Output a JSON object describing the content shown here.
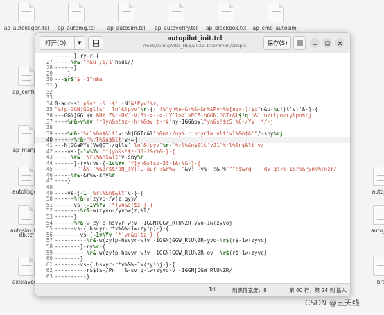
{
  "desktop": {
    "icons": [
      {
        "label": "ap_autolibgen.tcl",
        "col": 0,
        "row": 0
      },
      {
        "label": "ap_automg.tcl",
        "col": 1,
        "row": 0
      },
      {
        "label": "ap_autosim.tcl",
        "col": 2,
        "row": 0
      },
      {
        "label": "ap_autoverify.tcl",
        "col": 3,
        "row": 0
      },
      {
        "label": "ap_blackbox.tcl",
        "col": 4,
        "row": 0
      },
      {
        "label": "ap_cmd_autosim_",
        "col": 5,
        "row": 0
      },
      {
        "label": "ap_config_",
        "col": 0,
        "row": 1
      },
      {
        "label": "ap_manpa",
        "col": 0,
        "row": 2
      },
      {
        "label": "autolibgen",
        "col": 0,
        "row": 3
      },
      {
        "label": "auto_rt",
        "col": 6,
        "row": 3
      },
      {
        "label": "autosim_typ",
        "col": 0,
        "row": 4
      },
      {
        "label": "db.tcl",
        "col": 0,
        "row": 4.3
      },
      {
        "label": "auto_ve",
        "col": 6,
        "row": 4
      },
      {
        "label": "axislavege",
        "col": 0,
        "row": 5
      },
      {
        "label": "bra",
        "col": 6,
        "row": 5
      }
    ]
  },
  "window": {
    "open_label": "打开(O)",
    "title": "autopilot_init.tcl",
    "path": "/tools/Xilinx/Vitis_HLS/2022.1/common/scripts",
    "save_label": "保存(S)"
  },
  "editor": {
    "lines": [
      {
        "n": "",
        "parts": [
          [
            "",
            "------}-ry-r-{"
          ]
        ]
      },
      {
        "n": "27",
        "parts": [
          [
            "",
            "-----"
          ],
          [
            "k",
            "%r&"
          ],
          [
            "",
            "-"
          ],
          [
            "s",
            "\"n&u-/i/1\""
          ],
          [
            "",
            "n&ui//"
          ]
        ]
      },
      {
        "n": "28",
        "parts": [
          [
            "",
            "------}"
          ]
        ]
      },
      {
        "n": "29",
        "parts": [
          [
            "",
            "----}"
          ]
        ]
      },
      {
        "n": "30",
        "parts": [
          [
            "",
            "---"
          ],
          [
            "k",
            "$r&"
          ],
          [
            "s",
            "'$ -1\"n&u"
          ]
        ]
      },
      {
        "n": "31",
        "parts": [
          [
            "",
            ")"
          ]
        ]
      },
      {
        "n": "32",
        "parts": [
          [
            "",
            ""
          ]
        ]
      },
      {
        "n": "33",
        "parts": [
          [
            "",
            ""
          ]
        ]
      },
      {
        "n": "34",
        "parts": [
          [
            "",
            "0-aur-s"
          ],
          [
            "s",
            "' p&v! -&!-$' "
          ],
          [
            "",
            "-N"
          ],
          [
            "s",
            "'&!Pyv\"%r;"
          ]
        ]
      },
      {
        "n": "35",
        "parts": [
          [
            "s",
            "\"$!p-GGN|GGgl!$' "
          ],
          [
            "",
            " "
          ],
          [
            "s",
            "ln'&!pyv\""
          ],
          [
            "k",
            "%r"
          ],
          [
            "",
            "-{- "
          ],
          [
            "s",
            "!%\"yn%u-&r%&-&r%&Pyn%%[nzr-)!$x\""
          ],
          [
            "",
            "n&u-"
          ],
          [
            "k",
            "%u!"
          ],
          [
            "",
            ")t'v!'&-}-{"
          ]
        ]
      },
      {
        "n": "36",
        "parts": [
          [
            "",
            "---GGN]GG'$v "
          ],
          [
            "s",
            "&UY'Z%t-UY'-V|5\\->-->-UY'l>=l>EC8-hGGN]GGTr&l"
          ],
          [
            "k",
            "$!q"
          ],
          [
            "s",
            "'p&l nzrlpnzrylpn%rj"
          ]
        ]
      },
      {
        "n": "37",
        "parts": [
          [
            "",
            "----"
          ],
          [
            "k",
            "%r&-v%Yv"
          ],
          [
            "s",
            " '*]yn&s!$z--h-%&$v t-r#'"
          ],
          [
            "",
            "ny-1GG&pyl"
          ],
          [
            "s",
            "\"yn&s!$z5!%6-/Yv '*/-j"
          ]
        ]
      },
      {
        "n": "38",
        "parts": [
          [
            "",
            ""
          ]
        ]
      },
      {
        "n": "39",
        "parts": [
          [
            "",
            "----"
          ],
          [
            "k",
            "%r&"
          ],
          [
            "",
            "-"
          ],
          [
            "s",
            "'%rl%&n$&lt'"
          ],
          [
            "",
            "v-hN]GGTr&l"
          ],
          [
            "s",
            "\"n&nz-/uy%;r noyrlw vlt'vl%&n$&'\""
          ],
          [
            "",
            "/-sny"
          ],
          [
            "k",
            "%rj"
          ]
        ]
      },
      {
        "n": "40",
        "current": true,
        "parts": [
          [
            "",
            "------"
          ],
          [
            "k",
            "%r&"
          ],
          [
            "",
            "-"
          ],
          [
            "s",
            "'%rl%&n$&lt'"
          ],
          [
            "",
            "v-="
          ],
          [
            "cursor",
            ""
          ],
          [
            "",
            "|"
          ]
        ]
      },
      {
        "n": "41",
        "parts": [
          [
            "",
            "---N]GGaPYV[VaQOT-/qlls' "
          ],
          [
            "s",
            "ln'&!pyv\""
          ],
          [
            "k",
            "%r"
          ],
          [
            "",
            "-"
          ],
          [
            "s",
            "'%rl%&n$&lt'vJ1'%rl%&n$&lt'v/"
          ]
        ]
      },
      {
        "n": "42",
        "parts": [
          [
            "",
            "----vs-{"
          ],
          [
            "k",
            "-1v%Yv"
          ],
          [
            "s",
            " '*]yn&s!$z-33-1&r%&-}-{"
          ]
        ]
      },
      {
        "n": "43",
        "parts": [
          [
            "",
            "-----"
          ],
          [
            "k",
            "%r&"
          ],
          [
            "",
            "-"
          ],
          [
            "s",
            "'%rl%&n$&lt'"
          ],
          [
            "",
            "v-sny"
          ],
          [
            "k",
            "%r"
          ]
        ]
      },
      {
        "n": "44",
        "parts": [
          [
            "",
            "------}-ry%rvs-{"
          ],
          [
            "k",
            "-1v%Yv"
          ],
          [
            "s",
            " '*]yn&s!$z-33-1&r%&-}-{"
          ]
        ]
      },
      {
        "n": "45",
        "parts": [
          [
            "",
            "-------"
          ],
          [
            "s",
            "\"'&%-'%&qr$$/dN_[V[TG-aur-:&r%&-!\""
          ],
          [
            "",
            "&v! -v%- !&-%"
          ],
          [
            "s",
            "'\"\"!$&rq-! -dv q!)%-1&r%&Pyn%%[nzr/"
          ]
        ]
      },
      {
        "n": "46",
        "parts": [
          [
            "",
            "-----"
          ],
          [
            "k",
            "%r&"
          ],
          [
            "",
            "-&r%&-sny"
          ],
          [
            "k",
            "%r"
          ]
        ]
      },
      {
        "n": "47",
        "parts": [
          [
            "",
            "----}"
          ]
        ]
      },
      {
        "n": "48",
        "parts": [
          [
            "",
            ""
          ]
        ]
      },
      {
        "n": "49",
        "parts": [
          [
            "",
            "----vs-{"
          ],
          [
            "k",
            "-1"
          ],
          [
            "",
            " "
          ],
          [
            "s",
            "'%rl%&n$&lt'"
          ],
          [
            "",
            "v-}-{"
          ]
        ]
      },
      {
        "n": "50",
        "parts": [
          [
            "",
            "------"
          ],
          [
            "k",
            "%r&"
          ],
          [
            "",
            "-w(zyvo-/w(z;qyy/"
          ]
        ]
      },
      {
        "n": "51",
        "parts": [
          [
            "",
            "------vs-{"
          ],
          [
            "k",
            "-1v%Yv"
          ],
          [
            "s",
            " '*]yn&s!$z-}-{"
          ]
        ]
      },
      {
        "n": "52",
        "parts": [
          [
            "",
            "--------"
          ],
          [
            "k",
            "%r&"
          ],
          [
            "",
            "-w(zyvo-/yvow(z;%l/"
          ]
        ]
      },
      {
        "n": "53",
        "parts": [
          [
            "",
            "------}"
          ]
        ]
      },
      {
        "n": "54",
        "parts": [
          [
            "",
            "------"
          ],
          [
            "k",
            "%r&"
          ],
          [
            "",
            "-w(zy!p-hsvyr-w!v -1GGN]GGW_RlU\\ZR-yvo-1w(zyvoj"
          ]
        ]
      },
      {
        "n": "55",
        "parts": [
          [
            "",
            "------vs-{.hsvyr-r*v%&%-1w(zy!p]-}-{"
          ]
        ]
      },
      {
        "n": "56",
        "parts": [
          [
            "",
            "--------vs-{"
          ],
          [
            "k",
            "-1v%Yv"
          ],
          [
            "s",
            " '*]yn&s!$z-}-{"
          ]
        ]
      },
      {
        "n": "57",
        "parts": [
          [
            "",
            "----------"
          ],
          [
            "k",
            "%r&"
          ],
          [
            "",
            "-w(zy!p-hsvyr-w!v -1GGN]GGW_RlU\\ZR-yvo-"
          ],
          [
            "k",
            "%r$"
          ],
          [
            "",
            "(r$-1w(zyvoj"
          ]
        ]
      },
      {
        "n": "58",
        "parts": [
          [
            "",
            "--------}-ry"
          ],
          [
            "k",
            "%r"
          ],
          [
            "",
            "-{"
          ]
        ]
      },
      {
        "n": "59",
        "parts": [
          [
            "",
            "----------"
          ],
          [
            "k",
            "%r&"
          ],
          [
            "",
            "-w(zy!p-hsvyr-w!v -1GGN]GGW_RlU\\ZR-ov -"
          ],
          [
            "k",
            "%r$"
          ],
          [
            "",
            "(r$-1w(zyvoj"
          ]
        ]
      },
      {
        "n": "60",
        "parts": [
          [
            "",
            "--------}"
          ]
        ]
      },
      {
        "n": "61",
        "parts": [
          [
            "",
            "--------vs-{.hsvyr-r*v%&%-1w(zy!pj-}-{"
          ]
        ]
      },
      {
        "n": "62",
        "parts": [
          [
            "",
            "----------r$$!$-/Pn  !&-sv q-lw(zyvo-v -1GGN]GGW_RlU\\ZR/"
          ]
        ]
      },
      {
        "n": "63",
        "parts": [
          [
            "",
            "----------}"
          ]
        ]
      }
    ]
  },
  "status": {
    "language": "Tcl",
    "tab_width": "制表符宽度：8",
    "position": "第 40 行，第 24 列",
    "mode": "插入"
  },
  "watermark": "CSDN @五天线"
}
